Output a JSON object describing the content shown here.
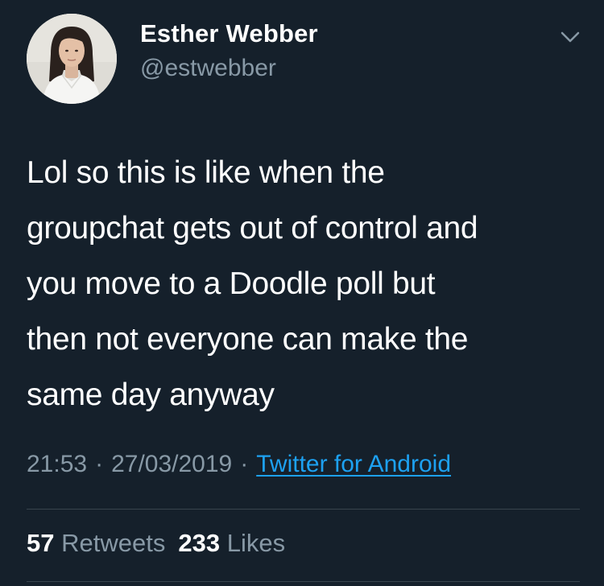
{
  "user": {
    "name": "Esther Webber",
    "handle": "@estwebber"
  },
  "tweet": {
    "lines": [
      "Lol so this is like when the",
      "groupchat gets out of control and",
      "you move to a Doodle poll but",
      "then not everyone can make the",
      "same day anyway"
    ],
    "time": "21:53",
    "date": "27/03/2019",
    "source": "Twitter for Android"
  },
  "stats": {
    "retweets_count": "57",
    "retweets_label": "Retweets",
    "likes_count": "233",
    "likes_label": "Likes"
  },
  "icons": {
    "menu": "chevron-down-icon"
  },
  "colors": {
    "background": "#15202b",
    "text": "#ffffff",
    "muted": "#8899a6",
    "link": "#1da1f2",
    "divider": "#38444d"
  }
}
